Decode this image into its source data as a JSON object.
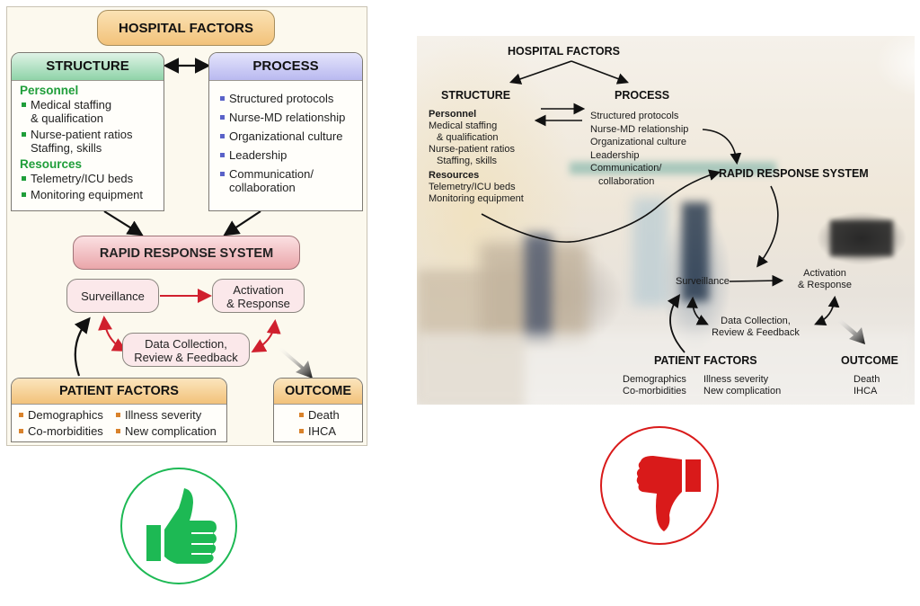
{
  "good_example": {
    "hospital_factors": "HOSPITAL FACTORS",
    "structure": {
      "title": "STRUCTURE",
      "personnel_label": "Personnel",
      "personnel_items": [
        "Medical staffing",
        "& qualification",
        "Nurse-patient ratios",
        "Staffing, skills"
      ],
      "resources_label": "Resources",
      "resources_items": [
        "Telemetry/ICU beds",
        "Monitoring equipment"
      ]
    },
    "process": {
      "title": "PROCESS",
      "items": [
        "Structured protocols",
        "Nurse-MD relationship",
        "Organizational culture",
        "Leadership",
        "Communication/",
        "collaboration"
      ]
    },
    "rapid_response": "RAPID RESPONSE SYSTEM",
    "surveillance": "Surveillance",
    "activation": [
      "Activation",
      "& Response"
    ],
    "data_collection": [
      "Data Collection,",
      "Review & Feedback"
    ],
    "patient_factors": {
      "title": "PATIENT FACTORS",
      "items": [
        "Demographics",
        "Illness severity",
        "Co-morbidities",
        "New complication"
      ]
    },
    "outcome": {
      "title": "OUTCOME",
      "items": [
        "Death",
        "IHCA"
      ]
    },
    "colors": {
      "structure_header": "#8fd3a8",
      "process_header": "#b9b9f0",
      "hospital_header": "#f7cf8a",
      "rapid_header": "#eaa6aa",
      "pill_fill": "#fbe8ea",
      "green_bullet": "#1f9e3a",
      "blue_bullet": "#5a62c8",
      "orange_bullet": "#d9822b",
      "red_arrow": "#d0202e"
    }
  },
  "bad_example": {
    "hospital_factors": "HOSPITAL FACTORS",
    "structure": {
      "title": "STRUCTURE",
      "personnel_label": "Personnel",
      "personnel_items": [
        "Medical staffing",
        "& qualification",
        "Nurse-patient ratios",
        "Staffing, skills"
      ],
      "resources_label": "Resources",
      "resources_items": [
        "Telemetry/ICU beds",
        "Monitoring equipment"
      ]
    },
    "process": {
      "title": "PROCESS",
      "items": [
        "Structured protocols",
        "Nurse-MD relationship",
        "Organizational culture",
        "Leadership",
        "Communication/",
        "collaboration"
      ]
    },
    "rapid_response": "RAPID RESPONSE SYSTEM",
    "surveillance": "Surveillance",
    "activation": [
      "Activation",
      "& Response"
    ],
    "data_collection": [
      "Data Collection,",
      "Review & Feedback"
    ],
    "patient_factors": {
      "title": "PATIENT FACTORS",
      "items": [
        "Demographics",
        "Illness severity",
        "Co-morbidities",
        "New complication"
      ]
    },
    "outcome": {
      "title": "OUTCOME",
      "items": [
        "Death",
        "IHCA"
      ]
    }
  },
  "verdicts": {
    "good": {
      "icon": "thumbs-up",
      "color": "#1db954"
    },
    "bad": {
      "icon": "thumbs-down",
      "color": "#d91a1a"
    }
  }
}
